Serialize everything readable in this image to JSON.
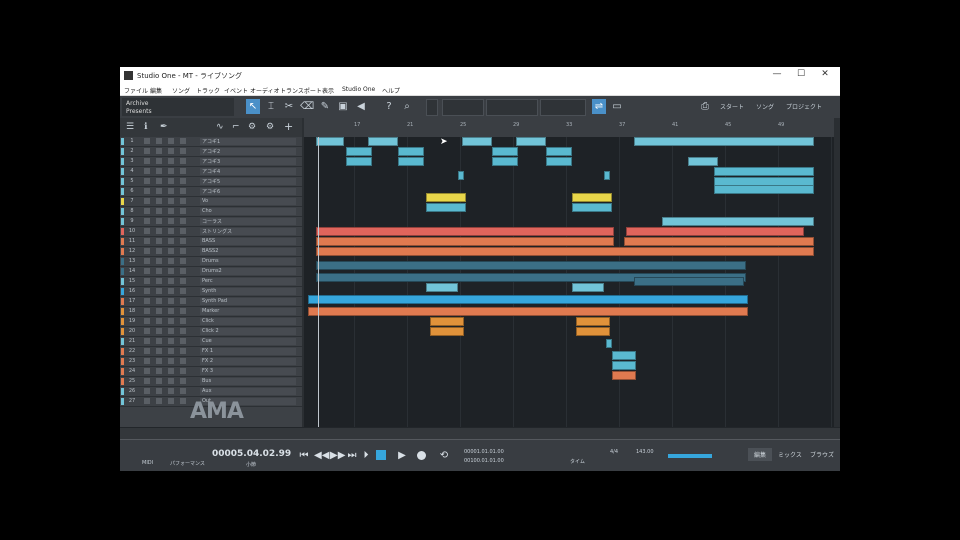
{
  "titlebar": {
    "title": "Studio One - MT - ライブソング",
    "min": "—",
    "max": "☐",
    "close": "✕"
  },
  "menu": [
    "ファイル",
    "編集",
    "ソング",
    "トラック",
    "イベント",
    "オーディオ",
    "トランスポート",
    "表示",
    "Studio One",
    "ヘルプ"
  ],
  "song": {
    "name": "Archive",
    "sub": "Presents"
  },
  "toolbar": {
    "tabs": [
      "スタート",
      "ソング",
      "プロジェクト"
    ],
    "help": "?",
    "search": "⌕"
  },
  "ruler": {
    "ticks": [
      "17",
      "21",
      "25",
      "29",
      "33",
      "37",
      "41",
      "45",
      "49"
    ]
  },
  "tracks": [
    {
      "n": "1",
      "name": "アコギ1",
      "color": "#72c4d8"
    },
    {
      "n": "2",
      "name": "アコギ2",
      "color": "#72c4d8"
    },
    {
      "n": "3",
      "name": "アコギ3",
      "color": "#72c4d8"
    },
    {
      "n": "4",
      "name": "アコギ4",
      "color": "#72c4d8"
    },
    {
      "n": "5",
      "name": "アコギ5",
      "color": "#72c4d8"
    },
    {
      "n": "6",
      "name": "アコギ6",
      "color": "#72c4d8"
    },
    {
      "n": "7",
      "name": "Vo",
      "color": "#e8d64a"
    },
    {
      "n": "8",
      "name": "Cho",
      "color": "#72c4d8"
    },
    {
      "n": "9",
      "name": "コーラス",
      "color": "#72c4d8"
    },
    {
      "n": "10",
      "name": "ストリングス",
      "color": "#e0655c"
    },
    {
      "n": "11",
      "name": "BASS",
      "color": "#e07a50"
    },
    {
      "n": "12",
      "name": "BASS2",
      "color": "#e07a50"
    },
    {
      "n": "13",
      "name": "Drums",
      "color": "#3b6f86"
    },
    {
      "n": "14",
      "name": "Drums2",
      "color": "#3b6f86"
    },
    {
      "n": "15",
      "name": "Perc",
      "color": "#72c4d8"
    },
    {
      "n": "16",
      "name": "Synth",
      "color": "#36a6dc"
    },
    {
      "n": "17",
      "name": "Synth Pad",
      "color": "#e07a50"
    },
    {
      "n": "18",
      "name": "Marker",
      "color": "#e0923a"
    },
    {
      "n": "19",
      "name": "Click",
      "color": "#e0923a"
    },
    {
      "n": "20",
      "name": "Click 2",
      "color": "#e0923a"
    },
    {
      "n": "21",
      "name": "Cue",
      "color": "#72c4d8"
    },
    {
      "n": "22",
      "name": "FX 1",
      "color": "#e07a50"
    },
    {
      "n": "23",
      "name": "FX 2",
      "color": "#e07a50"
    },
    {
      "n": "24",
      "name": "FX 3",
      "color": "#e07a50"
    },
    {
      "n": "25",
      "name": "Bus",
      "color": "#e07a50"
    },
    {
      "n": "26",
      "name": "Aux",
      "color": "#72c4d8"
    },
    {
      "n": "27",
      "name": "Out",
      "color": "#72c4d8"
    }
  ],
  "logo_text": "AMA",
  "transport": {
    "time": "00005.04.02.99",
    "time_sub": "小節",
    "loop_start": "00001.01.01.00",
    "loop_end": "00100.01.01.00",
    "signature": "4/4",
    "tempo": "143.00",
    "tabs": [
      "編集",
      "ミックス",
      "ブラウズ"
    ],
    "labels": {
      "midi": "MIDI",
      "perf": "パフォーマンス",
      "time": "タイム"
    }
  }
}
